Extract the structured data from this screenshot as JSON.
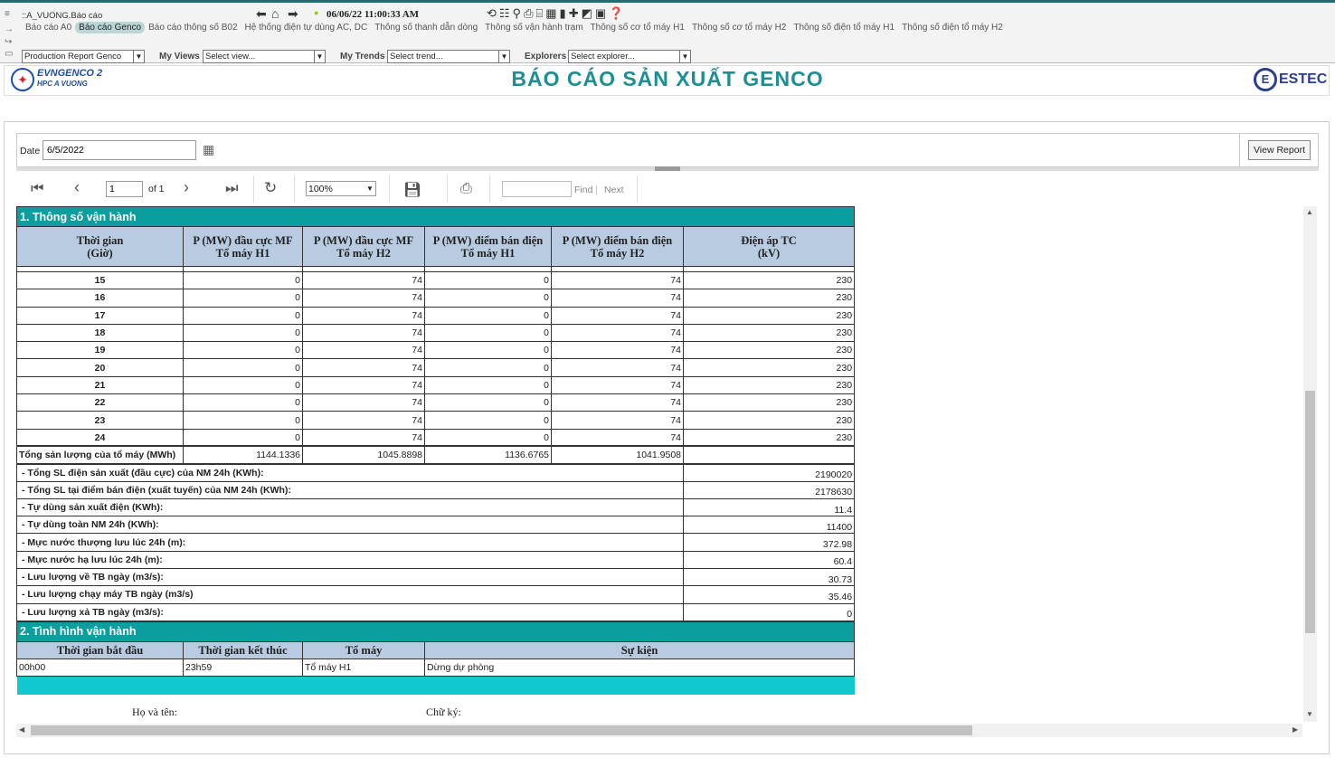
{
  "app": {
    "path": "::A_VUONG.Báo cáo",
    "datetime": "06/06/22 11:00:33 AM",
    "tabs": [
      "Báo cáo A0",
      "Báo cáo Genco",
      "Báo cáo thông số B02",
      "Hệ thống điện tự dùng AC, DC",
      "Thông số thanh dẫn dòng",
      "Thông số vận hành trạm",
      "Thông số cơ tổ máy H1",
      "Thông số cơ tổ máy H2",
      "Thông số điện tổ máy H1",
      "Thông số điện tổ máy H2"
    ],
    "active_tab": "Báo cáo Genco"
  },
  "selectors": {
    "report": "Production Report Genco",
    "views_label": "My Views",
    "views": "Select view...",
    "trends_label": "My Trends",
    "trends": "Select trend...",
    "explorers_label": "Explorers",
    "explorers": "Select explorer..."
  },
  "header": {
    "logo_line1": "EVNGENCO 2",
    "logo_line2": "HPC A VUONG",
    "title": "BÁO CÁO SẢN XUẤT GENCO",
    "brand": "ESTEC"
  },
  "params": {
    "date_label": "Date",
    "date_value": "6/5/2022",
    "view_report": "View Report"
  },
  "toolbar": {
    "page": "1",
    "of": "of 1",
    "zoom": "100%",
    "find": "Find",
    "next": "Next"
  },
  "section1": {
    "title": "1. Thông số vận hành",
    "headers": [
      "Thời gian\n(Giờ)",
      "P (MW) đầu cực MF\nTổ máy H1",
      "P (MW) đầu cực MF\nTổ máy H2",
      "P (MW) điểm bán điện\nTổ máy H1",
      "P (MW) điểm bán điện\nTổ máy H2",
      "Điện áp TC\n(kV)"
    ],
    "rows": [
      [
        "15",
        "0",
        "74",
        "0",
        "74",
        "230"
      ],
      [
        "16",
        "0",
        "74",
        "0",
        "74",
        "230"
      ],
      [
        "17",
        "0",
        "74",
        "0",
        "74",
        "230"
      ],
      [
        "18",
        "0",
        "74",
        "0",
        "74",
        "230"
      ],
      [
        "19",
        "0",
        "74",
        "0",
        "74",
        "230"
      ],
      [
        "20",
        "0",
        "74",
        "0",
        "74",
        "230"
      ],
      [
        "21",
        "0",
        "74",
        "0",
        "74",
        "230"
      ],
      [
        "22",
        "0",
        "74",
        "0",
        "74",
        "230"
      ],
      [
        "23",
        "0",
        "74",
        "0",
        "74",
        "230"
      ],
      [
        "24",
        "0",
        "74",
        "0",
        "74",
        "230"
      ]
    ],
    "total": [
      "Tổng sản lượng của tổ máy (MWh)",
      "1144.1336",
      "1045.8898",
      "1136.6765",
      "1041.9508",
      ""
    ],
    "summary": [
      [
        "- Tổng SL điện sản xuất (đầu cực) của NM 24h (KWh):",
        "2190020"
      ],
      [
        "- Tổng SL tại điểm bán điện (xuất tuyến) của NM 24h (KWh):",
        "2178630"
      ],
      [
        "- Tự dùng sản xuất điện (KWh):",
        "11.4"
      ],
      [
        "- Tự dùng toàn NM 24h (KWh):",
        "11400"
      ],
      [
        "- Mực nước thượng lưu lúc 24h (m):",
        "372.98"
      ],
      [
        "- Mực nước hạ lưu lúc 24h (m):",
        "60.4"
      ],
      [
        "- Lưu lượng về TB ngày (m3/s):",
        "30.73"
      ],
      [
        "- Lưu lượng chạy máy TB ngày (m3/s)",
        "35.46"
      ],
      [
        "- Lưu lượng xả TB ngày (m3/s):",
        "0"
      ]
    ]
  },
  "section2": {
    "title": "2. Tình hình vận hành",
    "headers": [
      "Thời gian bắt đầu",
      "Thời gian kết thúc",
      "Tổ máy",
      "Sự kiện"
    ],
    "rows": [
      [
        "00h00",
        "23h59",
        "Tổ máy H1",
        "Dừng dự phòng"
      ]
    ]
  },
  "footer": {
    "name_label": "Họ và tên:",
    "sign_label": "Chữ ký:"
  },
  "colors": {
    "accent": "#0a9e9e",
    "header_bg": "#b8cbe0",
    "title": "#1b8f94"
  }
}
